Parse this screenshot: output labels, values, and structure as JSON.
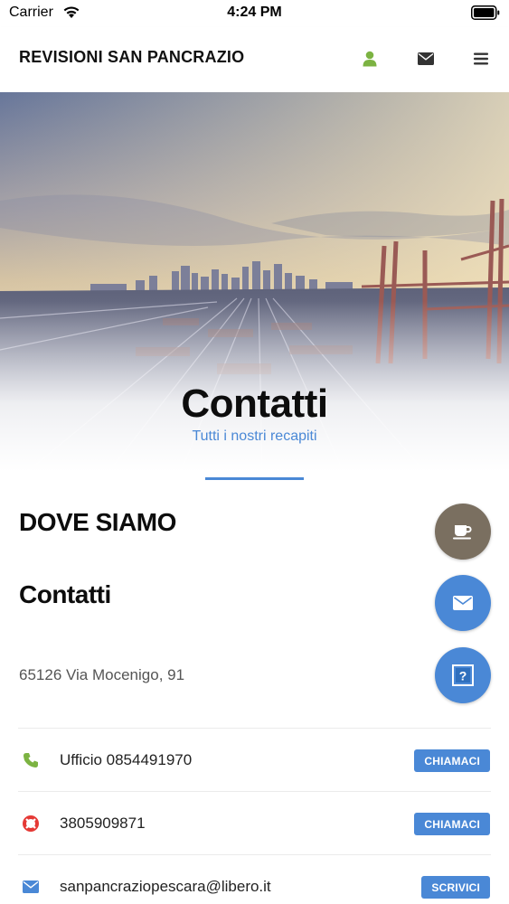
{
  "status_bar": {
    "carrier": "Carrier",
    "time": "4:24 PM"
  },
  "header": {
    "title": "REVISIONI SAN PANCRAZIO",
    "icons": [
      "user-icon",
      "envelope-icon",
      "menu-icon"
    ],
    "user_icon_color": "#7cb342",
    "icon_color": "#333333"
  },
  "hero": {
    "title": "Contatti",
    "subtitle": "Tutti i nostri recapiti"
  },
  "sections": {
    "where": "DOVE SIAMO",
    "contacts": "Contatti"
  },
  "address": "65126 Via Mocenigo, 91",
  "fab": [
    {
      "icon": "coffee-icon",
      "color": "#7a6f60"
    },
    {
      "icon": "envelope-icon",
      "color": "#4a88d6"
    },
    {
      "icon": "question-icon",
      "color": "#4a88d6"
    }
  ],
  "contacts": [
    {
      "icon": "phone-icon",
      "icon_color": "#7cb342",
      "text": "Ufficio 0854491970",
      "button": "CHIAMACI"
    },
    {
      "icon": "lifebuoy-icon",
      "icon_color": "#e53935",
      "text": "3805909871",
      "button": "CHIAMACI"
    },
    {
      "icon": "envelope-icon",
      "icon_color": "#4a88d6",
      "text": "sanpancraziopescara@libero.it",
      "button": "SCRIVICI"
    }
  ],
  "colors": {
    "accent": "#4a88d6"
  }
}
